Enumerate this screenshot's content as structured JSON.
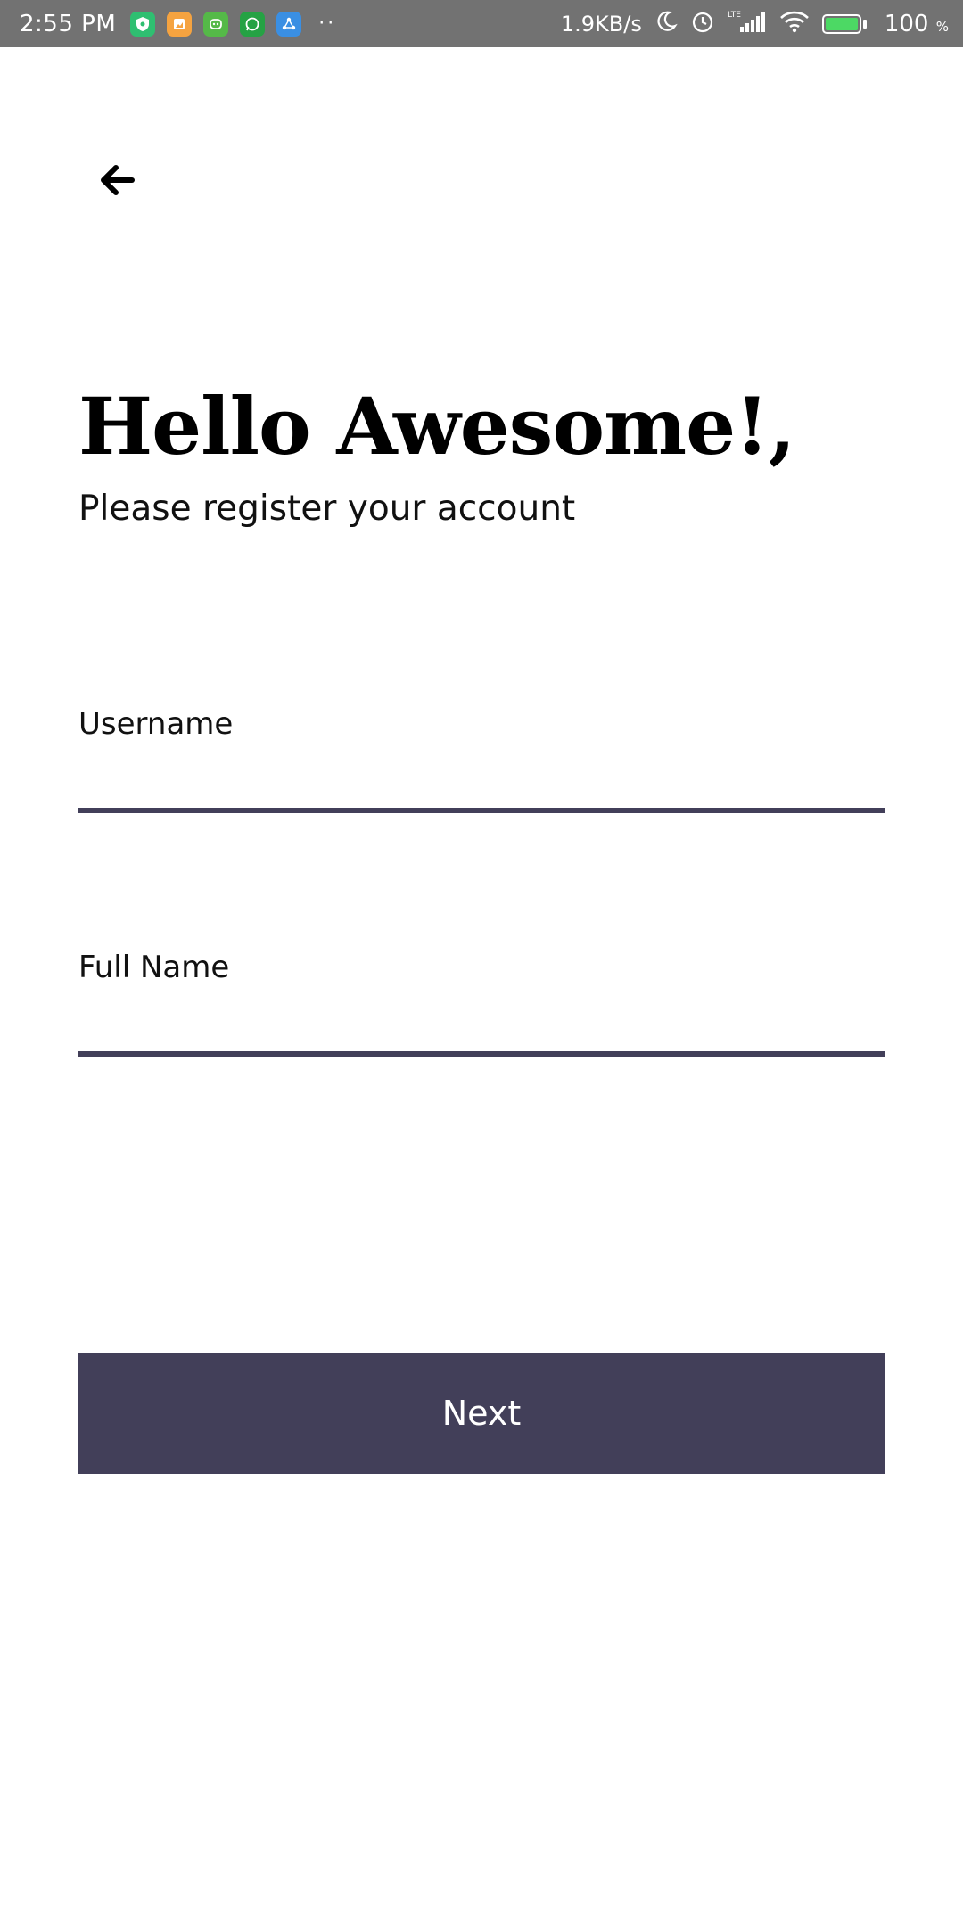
{
  "status_bar": {
    "time": "2:55 PM",
    "apps": [
      {
        "icon": "shield-app-icon",
        "color": "#2fbf71"
      },
      {
        "icon": "photos-app-icon",
        "color": "#f5a340"
      },
      {
        "icon": "android-app-icon",
        "color": "#55b948"
      },
      {
        "icon": "whatsapp-icon",
        "color": "#25a244"
      },
      {
        "icon": "shareit-icon",
        "color": "#3a8fe3"
      }
    ],
    "more": "··",
    "network_speed": "1.9KB/s",
    "battery_percent": "100",
    "battery_unit": "%",
    "network_type": "LTE"
  },
  "header": {
    "back_icon": "arrow-left-icon"
  },
  "greeting": {
    "title": "Hello Awesome!,",
    "subtitle": "Please register your account"
  },
  "form": {
    "username": {
      "label": "Username",
      "value": "",
      "placeholder": ""
    },
    "full_name": {
      "label": "Full Name",
      "value": "",
      "placeholder": ""
    }
  },
  "actions": {
    "next_label": "Next"
  },
  "colors": {
    "primary": "#423f59",
    "status_bar": "#727272"
  }
}
